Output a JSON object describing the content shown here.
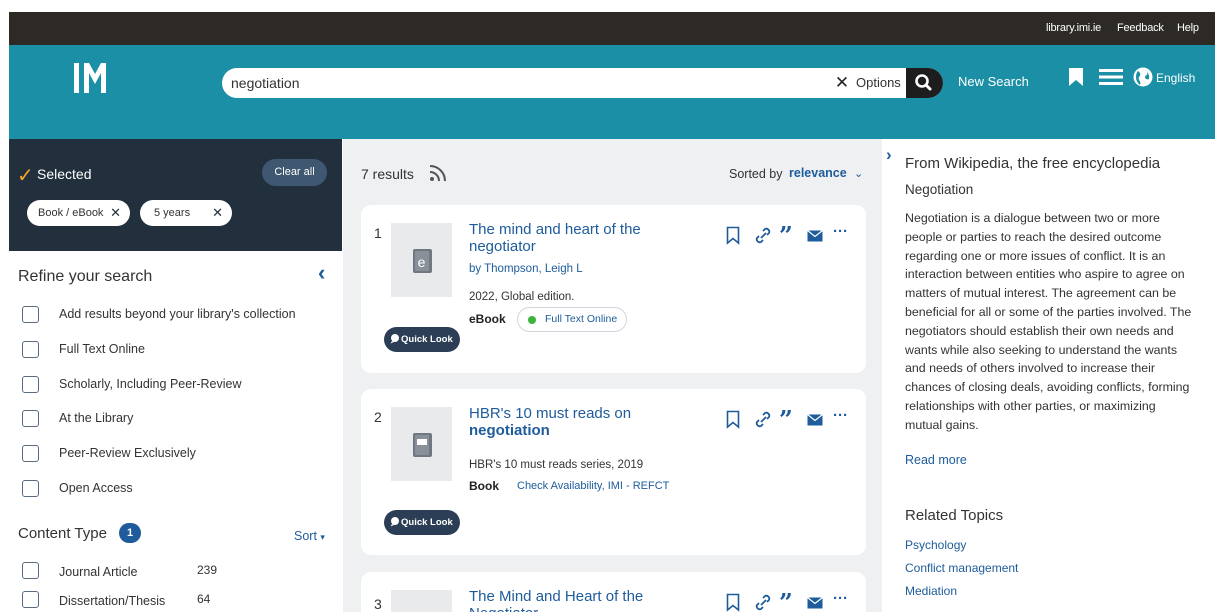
{
  "topbar": {
    "site": "library.imi.ie",
    "feedback": "Feedback",
    "help": "Help"
  },
  "header": {
    "search_value": "negotiation",
    "search_placeholder": "",
    "options_label": "Options",
    "new_search": "New Search",
    "language": "English",
    "brand_color": "#1b8fa5"
  },
  "selected": {
    "label": "Selected",
    "clear_all": "Clear all",
    "chips": [
      "Book / eBook",
      "5 years"
    ]
  },
  "refine": {
    "title": "Refine your search",
    "options": [
      "Add results beyond your library's collection",
      "Full Text Online",
      "Scholarly, Including Peer-Review",
      "At the Library",
      "Peer-Review Exclusively",
      "Open Access"
    ]
  },
  "content_type": {
    "title": "Content Type",
    "badge": "1",
    "sort": "Sort",
    "items": [
      {
        "label": "Journal Article",
        "count": "239"
      },
      {
        "label": "Dissertation/Thesis",
        "count": "64"
      }
    ]
  },
  "results": {
    "count": "7 results",
    "sorted_by": "Sorted by",
    "sort_value": "relevance",
    "quick_look": "Quick Look",
    "items": [
      {
        "num": "1",
        "title": "The mind and heart of the negotiator",
        "author": "by Thompson, Leigh L",
        "meta": "2022, Global edition.",
        "type": "eBook",
        "availability": "Full Text Online"
      },
      {
        "num": "2",
        "title_pre": "HBR's 10 must reads on",
        "title_bold": "negotiation",
        "meta": "HBR's 10 must reads series, 2019",
        "type": "Book",
        "availability": "Check Availability, IMI - REFCT"
      },
      {
        "num": "3",
        "title": "The Mind and Heart of the Negotiator"
      }
    ]
  },
  "wiki": {
    "source": "From Wikipedia, the free encyclopedia",
    "term": "Negotiation",
    "text": "Negotiation is a dialogue between two or more people or parties to reach the desired outcome regarding one or more issues of conflict. It is an interaction between entities who aspire to agree on matters of mutual interest. The agreement can be beneficial for all or some of the parties involved. The negotiators should establish their own needs and wants while also seeking to understand the wants and needs of others involved to increase their chances of closing deals, avoiding conflicts, forming relationships with other parties, or maximizing mutual gains.",
    "read_more": "Read more",
    "related_title": "Related Topics",
    "related": [
      "Psychology",
      "Conflict management",
      "Mediation"
    ]
  }
}
